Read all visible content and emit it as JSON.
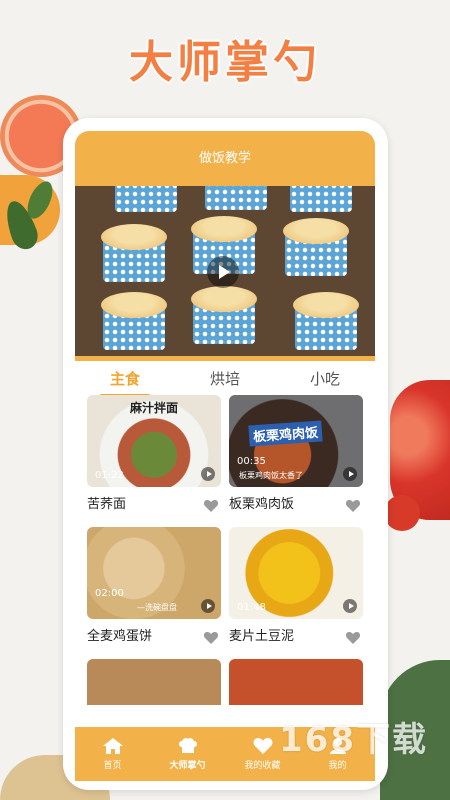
{
  "banner_title": "大师掌勺",
  "app": {
    "header_title": "做饭教学",
    "tabs": [
      {
        "label": "主食",
        "active": true
      },
      {
        "label": "烘培",
        "active": false
      },
      {
        "label": "小吃",
        "active": false
      }
    ],
    "cards": [
      {
        "title": "苦荞面",
        "duration": "01:22",
        "overlay": "麻汁拌面"
      },
      {
        "title": "板栗鸡肉饭",
        "duration": "00:35",
        "overlay": "板栗鸡肉饭",
        "caption": "板栗鸡肉饭太香了"
      },
      {
        "title": "全麦鸡蛋饼",
        "duration": "02:00",
        "caption": "—洗碗盘盘"
      },
      {
        "title": "麦片土豆泥",
        "duration": "01:48"
      }
    ],
    "tabbar": [
      {
        "label": "首页",
        "icon": "home-icon",
        "active": false
      },
      {
        "label": "大师掌勺",
        "icon": "chef-hat-icon",
        "active": true
      },
      {
        "label": "我的收藏",
        "icon": "heart-icon",
        "active": false
      },
      {
        "label": "我的",
        "icon": "user-icon",
        "active": false
      }
    ]
  },
  "watermark": "168下载",
  "colors": {
    "accent": "#f3b249",
    "title": "#f47f42",
    "active_tab": "#f0a531"
  }
}
